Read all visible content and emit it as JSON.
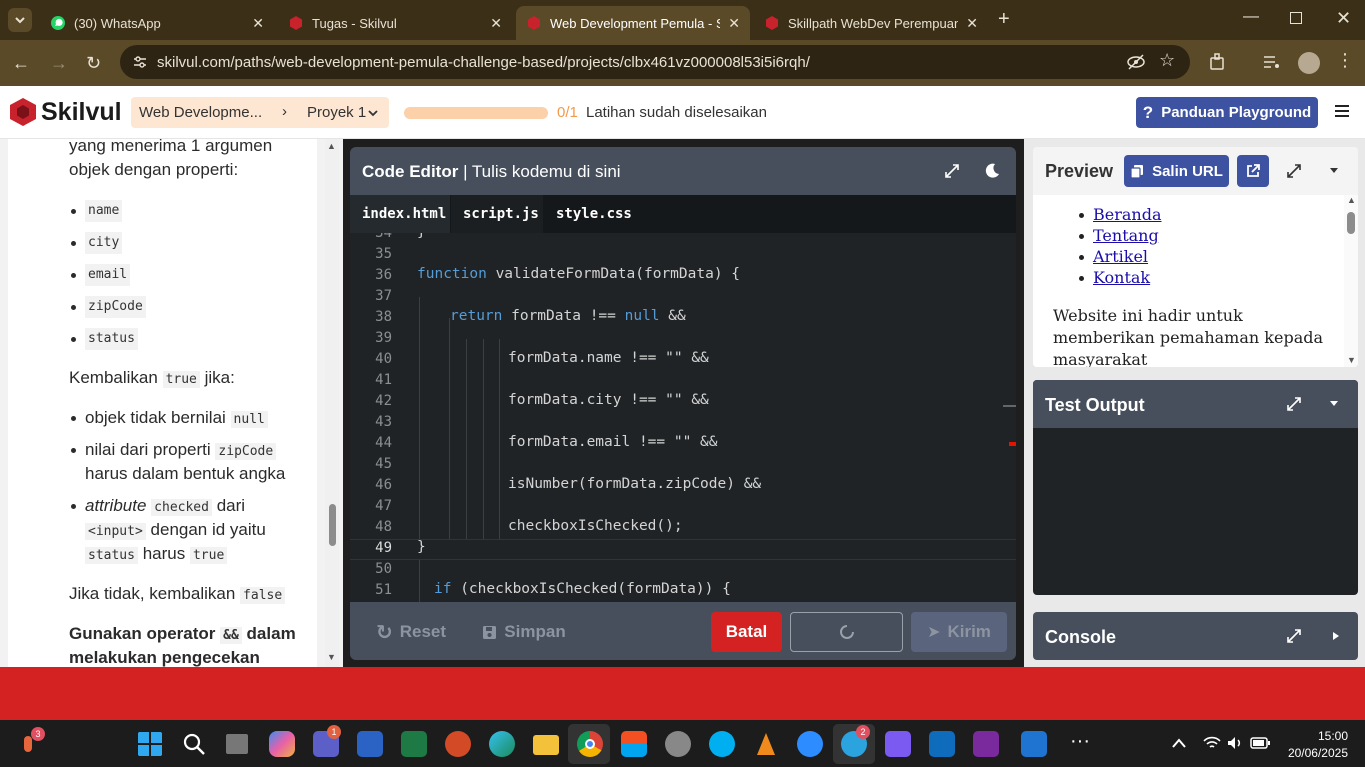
{
  "browser": {
    "tabs": [
      {
        "title": "(30) WhatsApp",
        "active": false
      },
      {
        "title": "Tugas - Skilvul",
        "active": false
      },
      {
        "title": "Web Development Pemula - Sp",
        "active": true
      },
      {
        "title": "Skillpath WebDev Perempuan In",
        "active": false
      }
    ],
    "url": "skilvul.com/paths/web-development-pemula-challenge-based/projects/clbx461vz000008l53i5i6rqh/"
  },
  "header": {
    "logo": "Skilvul",
    "breadcrumb_path": "Web Developme...",
    "breadcrumb_project": "Proyek 1",
    "progress_count": "0/1",
    "progress_fraction": 0,
    "progress_label": "Latihan sudah diselesaikan",
    "guide_button": "Panduan Playground"
  },
  "instructions": {
    "intro_line1": "yang menerima 1 argumen",
    "intro_line2": "objek dengan properti:",
    "props": [
      "name",
      "city",
      "email",
      "zipCode",
      "status"
    ],
    "return_a": "Kembalikan",
    "return_code": "true",
    "return_b": "jika:",
    "c1_a": "objek tidak bernilai",
    "c1_code": "null",
    "c2_a": "nilai dari properti",
    "c2_code": "zipCode",
    "c2_b": "harus dalam bentuk angka",
    "c3_a": "attribute",
    "c3_code1": "checked",
    "c3_b": "dari",
    "c3_code2": "<input>",
    "c3_c": "dengan id yaitu",
    "c3_code3": "status",
    "c3_d": "harus",
    "c3_code4": "true",
    "else_a": "Jika tidak, kembalikan",
    "else_code": "false",
    "note_a": "Gunakan operator",
    "note_code": "&&",
    "note_b": "dalam",
    "note_c": "melakukan pengecekan"
  },
  "editor": {
    "title": "Code Editor",
    "subtitle": "| Tulis kodemu di sini",
    "tabs": [
      "index.html",
      "script.js",
      "style.css"
    ],
    "lines": [
      {
        "n": "34",
        "code": "}"
      },
      {
        "n": "35",
        "code": ""
      },
      {
        "n": "36",
        "code": "function validateFormData(formData) {"
      },
      {
        "n": "37",
        "code": ""
      },
      {
        "n": "38",
        "code": "return formData !== null &&"
      },
      {
        "n": "39",
        "code": ""
      },
      {
        "n": "40",
        "code": "formData.name !== \"\" &&"
      },
      {
        "n": "41",
        "code": ""
      },
      {
        "n": "42",
        "code": "formData.city !== \"\" &&"
      },
      {
        "n": "43",
        "code": ""
      },
      {
        "n": "44",
        "code": "formData.email !== \"\" &&"
      },
      {
        "n": "45",
        "code": ""
      },
      {
        "n": "46",
        "code": "isNumber(formData.zipCode) &&"
      },
      {
        "n": "47",
        "code": ""
      },
      {
        "n": "48",
        "code": "checkboxIsChecked();"
      },
      {
        "n": "49",
        "code": "}"
      },
      {
        "n": "50",
        "code": ""
      },
      {
        "n": "51",
        "code": "if (checkboxIsChecked(formData)) {"
      }
    ],
    "reset": "Reset",
    "save": "Simpan",
    "cancel": "Batal",
    "submit": "Kirim"
  },
  "preview": {
    "title": "Preview",
    "copy_url": "Salin URL",
    "links": [
      "Beranda",
      "Tentang",
      "Artikel",
      "Kontak"
    ],
    "text": "Website ini hadir untuk memberikan pemahaman kepada masyarakat"
  },
  "test_output": {
    "title": "Test Output"
  },
  "console": {
    "title": "Console"
  },
  "taskbar": {
    "notif_badge": "3",
    "teams_badge": "1",
    "telegram_badge": "2",
    "time": "15:00",
    "date": "20/06/2025"
  }
}
